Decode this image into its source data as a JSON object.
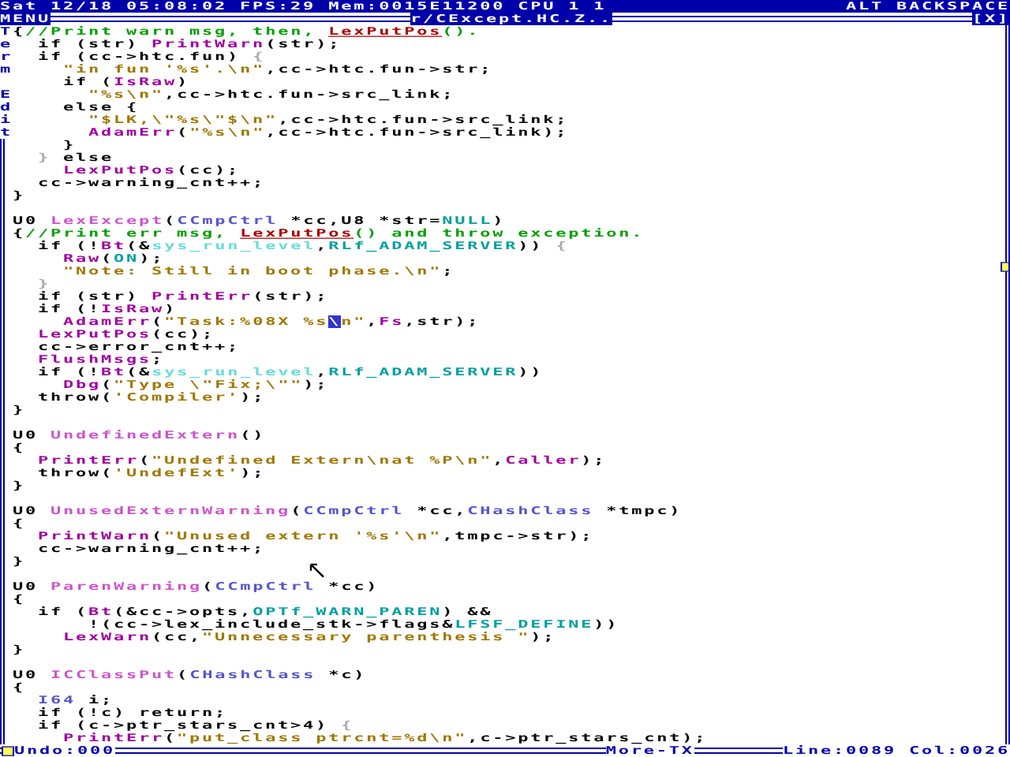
{
  "status_bar": {
    "left": "Sat 12/18 05:08:02 FPS:29 Mem:0015E11200 CPU 1 1",
    "right": "ALT BACKSPACE"
  },
  "window": {
    "menu": "MENU",
    "title": "r/CExcept.HC.Z..",
    "close": "[X]",
    "side_label": "Term Edit"
  },
  "blocks": [
    {
      "lines": [
        [
          {
            "kind": "plain",
            "text": "{"
          },
          {
            "kind": "comment",
            "text": "//Print warn msg, then, "
          },
          {
            "kind": "link",
            "text": "LexPutPos"
          },
          {
            "kind": "comment",
            "text": "()."
          }
        ],
        [
          {
            "kind": "plain",
            "text": "  if (str) "
          },
          {
            "kind": "fn",
            "text": "PrintWarn"
          },
          {
            "kind": "plain",
            "text": "(str);"
          }
        ],
        [
          {
            "kind": "plain",
            "text": "  if (cc->htc.fun) "
          },
          {
            "kind": "dim",
            "text": "{"
          }
        ],
        [
          {
            "kind": "string",
            "text": "    \"in fun '%s'.\\n\""
          },
          {
            "kind": "plain",
            "text": ",cc->htc.fun->str;"
          }
        ],
        [
          {
            "kind": "plain",
            "text": "    if ("
          },
          {
            "kind": "fn",
            "text": "IsRaw"
          },
          {
            "kind": "plain",
            "text": ")"
          }
        ],
        [
          {
            "kind": "string",
            "text": "      \"%s\\n\""
          },
          {
            "kind": "plain",
            "text": ",cc->htc.fun->src_link;"
          }
        ],
        [
          {
            "kind": "plain",
            "text": "    else {"
          }
        ],
        [
          {
            "kind": "string",
            "text": "      \"$LK,\\\"%s\\\"$\\n\""
          },
          {
            "kind": "plain",
            "text": ",cc->htc.fun->src_link;"
          }
        ],
        [
          {
            "kind": "fn",
            "text": "      AdamErr"
          },
          {
            "kind": "plain",
            "text": "("
          },
          {
            "kind": "string",
            "text": "\"%s\\n\""
          },
          {
            "kind": "plain",
            "text": ",cc->htc.fun->src_link);"
          }
        ],
        [
          {
            "kind": "plain",
            "text": "    }"
          }
        ],
        [
          {
            "kind": "dim",
            "text": "  }"
          },
          {
            "kind": "plain",
            "text": " else"
          }
        ],
        [
          {
            "kind": "fn",
            "text": "    LexPutPos"
          },
          {
            "kind": "plain",
            "text": "(cc);"
          }
        ],
        [
          {
            "kind": "plain",
            "text": "  cc->warning_cnt++;"
          }
        ],
        [
          {
            "kind": "plain",
            "text": "}"
          }
        ]
      ]
    },
    {
      "lines": [
        [
          {
            "kind": "plain",
            "text": "U0 "
          },
          {
            "kind": "def",
            "text": "LexExcept"
          },
          {
            "kind": "plain",
            "text": "("
          },
          {
            "kind": "type",
            "text": "CCmpCtrl"
          },
          {
            "kind": "plain",
            "text": " *cc,U8 *str="
          },
          {
            "kind": "const",
            "text": "NULL"
          },
          {
            "kind": "plain",
            "text": ")"
          }
        ],
        [
          {
            "kind": "plain",
            "text": "{"
          },
          {
            "kind": "comment",
            "text": "//Print err msg, "
          },
          {
            "kind": "link",
            "text": "LexPutPos"
          },
          {
            "kind": "comment",
            "text": "() and throw exception."
          }
        ],
        [
          {
            "kind": "plain",
            "text": "  if (!"
          },
          {
            "kind": "fn",
            "text": "Bt"
          },
          {
            "kind": "plain",
            "text": "(&"
          },
          {
            "kind": "global",
            "text": "sys_run_level"
          },
          {
            "kind": "plain",
            "text": ","
          },
          {
            "kind": "const",
            "text": "RLf_ADAM_SERVER"
          },
          {
            "kind": "plain",
            "text": ")) "
          },
          {
            "kind": "dim",
            "text": "{"
          }
        ],
        [
          {
            "kind": "fn",
            "text": "    Raw"
          },
          {
            "kind": "plain",
            "text": "("
          },
          {
            "kind": "const",
            "text": "ON"
          },
          {
            "kind": "plain",
            "text": ");"
          }
        ],
        [
          {
            "kind": "string",
            "text": "    \"Note: Still in boot phase.\\n\""
          },
          {
            "kind": "plain",
            "text": ";"
          }
        ],
        [
          {
            "kind": "dim",
            "text": "  }"
          }
        ],
        [
          {
            "kind": "plain",
            "text": "  if (str) "
          },
          {
            "kind": "fn",
            "text": "PrintErr"
          },
          {
            "kind": "plain",
            "text": "(str);"
          }
        ],
        [
          {
            "kind": "plain",
            "text": "  if (!"
          },
          {
            "kind": "fn",
            "text": "IsRaw"
          },
          {
            "kind": "plain",
            "text": ")"
          }
        ],
        [
          {
            "kind": "fn",
            "text": "    AdamErr"
          },
          {
            "kind": "plain",
            "text": "("
          },
          {
            "kind": "string",
            "text": "\"Task:%08X %s"
          },
          {
            "kind": "cursor",
            "text": "\\"
          },
          {
            "kind": "string",
            "text": "n\""
          },
          {
            "kind": "plain",
            "text": ","
          },
          {
            "kind": "fn",
            "text": "Fs"
          },
          {
            "kind": "plain",
            "text": ",str);"
          }
        ],
        [
          {
            "kind": "fn",
            "text": "  LexPutPos"
          },
          {
            "kind": "plain",
            "text": "(cc);"
          }
        ],
        [
          {
            "kind": "plain",
            "text": "  cc->error_cnt++;"
          }
        ],
        [
          {
            "kind": "fn",
            "text": "  FlushMsgs"
          },
          {
            "kind": "plain",
            "text": ";"
          }
        ],
        [
          {
            "kind": "plain",
            "text": "  if (!"
          },
          {
            "kind": "fn",
            "text": "Bt"
          },
          {
            "kind": "plain",
            "text": "(&"
          },
          {
            "kind": "global",
            "text": "sys_run_level"
          },
          {
            "kind": "plain",
            "text": ","
          },
          {
            "kind": "const",
            "text": "RLf_ADAM_SERVER"
          },
          {
            "kind": "plain",
            "text": "))"
          }
        ],
        [
          {
            "kind": "fn",
            "text": "    Dbg"
          },
          {
            "kind": "plain",
            "text": "("
          },
          {
            "kind": "string",
            "text": "\"Type \\\"Fix;\\\"\""
          },
          {
            "kind": "plain",
            "text": ");"
          }
        ],
        [
          {
            "kind": "plain",
            "text": "  throw("
          },
          {
            "kind": "string",
            "text": "'Compiler'"
          },
          {
            "kind": "plain",
            "text": ");"
          }
        ],
        [
          {
            "kind": "plain",
            "text": "}"
          }
        ]
      ]
    },
    {
      "lines": [
        [
          {
            "kind": "plain",
            "text": "U0 "
          },
          {
            "kind": "def",
            "text": "UndefinedExtern"
          },
          {
            "kind": "plain",
            "text": "()"
          }
        ],
        [
          {
            "kind": "plain",
            "text": "{"
          }
        ],
        [
          {
            "kind": "fn",
            "text": "  PrintErr"
          },
          {
            "kind": "plain",
            "text": "("
          },
          {
            "kind": "string",
            "text": "\"Undefined Extern\\nat %P\\n\""
          },
          {
            "kind": "plain",
            "text": ","
          },
          {
            "kind": "fn",
            "text": "Caller"
          },
          {
            "kind": "plain",
            "text": ");"
          }
        ],
        [
          {
            "kind": "plain",
            "text": "  throw("
          },
          {
            "kind": "string",
            "text": "'UndefExt'"
          },
          {
            "kind": "plain",
            "text": ");"
          }
        ],
        [
          {
            "kind": "plain",
            "text": "}"
          }
        ]
      ]
    },
    {
      "lines": [
        [
          {
            "kind": "plain",
            "text": "U0 "
          },
          {
            "kind": "def",
            "text": "UnusedExternWarning"
          },
          {
            "kind": "plain",
            "text": "("
          },
          {
            "kind": "type",
            "text": "CCmpCtrl"
          },
          {
            "kind": "plain",
            "text": " *cc,"
          },
          {
            "kind": "type",
            "text": "CHashClass"
          },
          {
            "kind": "plain",
            "text": " *tmpc)"
          }
        ],
        [
          {
            "kind": "plain",
            "text": "{"
          }
        ],
        [
          {
            "kind": "fn",
            "text": "  PrintWarn"
          },
          {
            "kind": "plain",
            "text": "("
          },
          {
            "kind": "string",
            "text": "\"Unused extern '%s'\\n\""
          },
          {
            "kind": "plain",
            "text": ",tmpc->str);"
          }
        ],
        [
          {
            "kind": "plain",
            "text": "  cc->warning_cnt++;"
          }
        ],
        [
          {
            "kind": "plain",
            "text": "}"
          }
        ]
      ]
    },
    {
      "lines": [
        [
          {
            "kind": "plain",
            "text": "U0 "
          },
          {
            "kind": "def",
            "text": "ParenWarning"
          },
          {
            "kind": "plain",
            "text": "("
          },
          {
            "kind": "type",
            "text": "CCmpCtrl"
          },
          {
            "kind": "plain",
            "text": " *cc)"
          }
        ],
        [
          {
            "kind": "plain",
            "text": "{"
          }
        ],
        [
          {
            "kind": "plain",
            "text": "  if ("
          },
          {
            "kind": "fn",
            "text": "Bt"
          },
          {
            "kind": "plain",
            "text": "(&cc->opts,"
          },
          {
            "kind": "const",
            "text": "OPTf_WARN_PAREN"
          },
          {
            "kind": "plain",
            "text": ") &&"
          }
        ],
        [
          {
            "kind": "plain",
            "text": "      !(cc->lex_include_stk->flags&"
          },
          {
            "kind": "const",
            "text": "LFSF_DEFINE"
          },
          {
            "kind": "plain",
            "text": "))"
          }
        ],
        [
          {
            "kind": "fn",
            "text": "    LexWarn"
          },
          {
            "kind": "plain",
            "text": "(cc,"
          },
          {
            "kind": "string",
            "text": "\"Unnecessary parenthesis \""
          },
          {
            "kind": "plain",
            "text": ");"
          }
        ],
        [
          {
            "kind": "plain",
            "text": "}"
          }
        ]
      ]
    },
    {
      "lines": [
        [
          {
            "kind": "plain",
            "text": "U0 "
          },
          {
            "kind": "def",
            "text": "ICClassPut"
          },
          {
            "kind": "plain",
            "text": "("
          },
          {
            "kind": "type",
            "text": "CHashClass"
          },
          {
            "kind": "plain",
            "text": " *c)"
          }
        ],
        [
          {
            "kind": "plain",
            "text": "{"
          }
        ],
        [
          {
            "kind": "type",
            "text": "  I64"
          },
          {
            "kind": "plain",
            "text": " i;"
          }
        ],
        [
          {
            "kind": "plain",
            "text": "  if (!c) return;"
          }
        ],
        [
          {
            "kind": "plain",
            "text": "  if (c->ptr_stars_cnt>4) "
          },
          {
            "kind": "dim",
            "text": "{"
          }
        ],
        [
          {
            "kind": "fn",
            "text": "    PrintErr"
          },
          {
            "kind": "plain",
            "text": "("
          },
          {
            "kind": "string",
            "text": "\"put_class ptrcnt=%d\\n\""
          },
          {
            "kind": "plain",
            "text": ",c->ptr_stars_cnt);"
          }
        ]
      ]
    }
  ],
  "bottom_bar": {
    "undo": "Undo:000",
    "more": "More-TX",
    "position": "Line:0089 Col:0026"
  }
}
